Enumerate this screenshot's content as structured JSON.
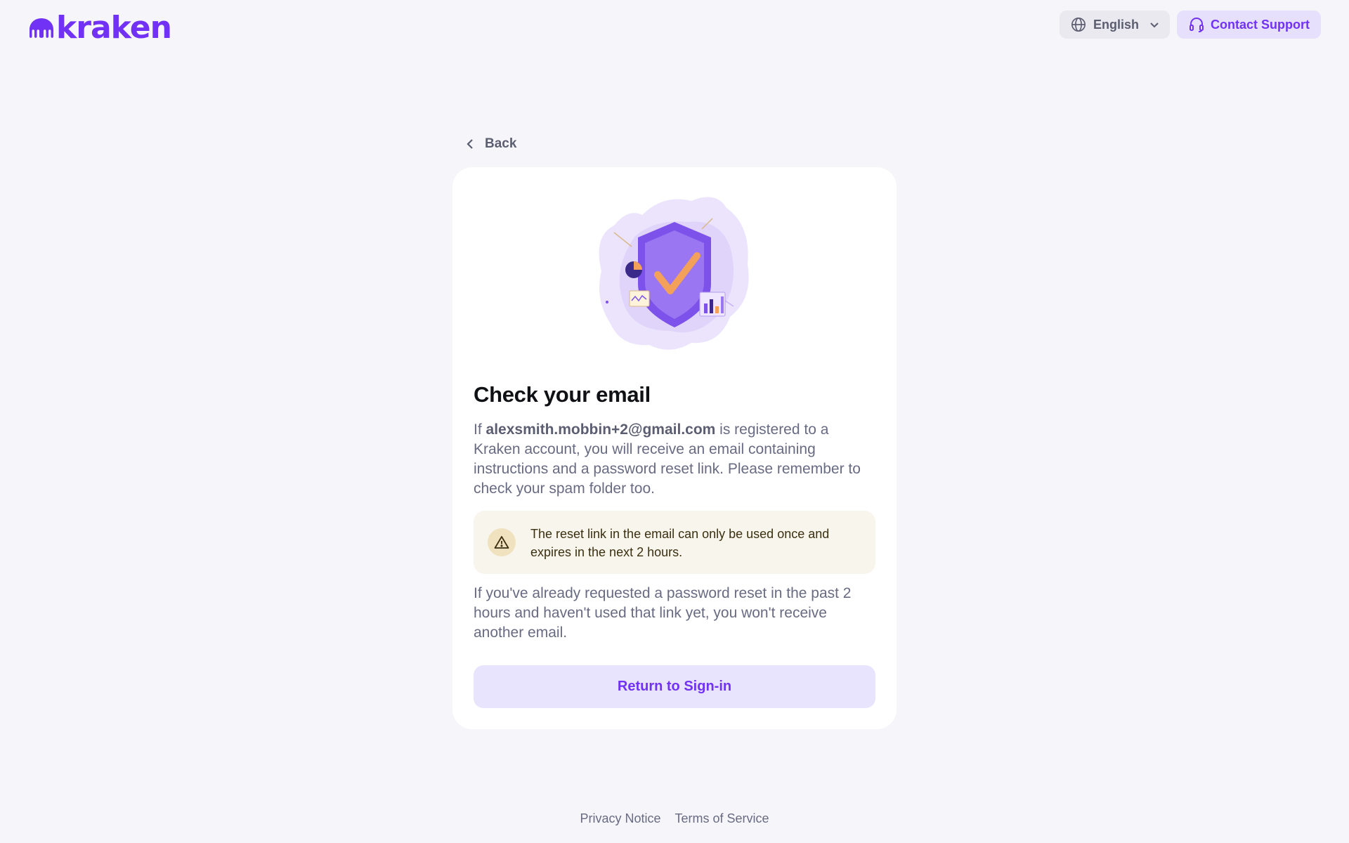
{
  "header": {
    "logo_text": "kraken",
    "language": {
      "label": "English",
      "icon": "globe-icon",
      "chevron": "chevron-down-icon"
    },
    "support": {
      "label": "Contact Support",
      "icon": "headset-icon"
    }
  },
  "back": {
    "label": "Back",
    "icon": "chevron-left-icon"
  },
  "card": {
    "illustration": "shield-check-illustration",
    "title": "Check your email",
    "para1": {
      "prefix": "If ",
      "email": "alexsmith.mobbin+2@gmail.com",
      "suffix": " is registered to a Kraken account, you will receive an email containing instructions and a password reset link. Please remember to check your spam folder too."
    },
    "warning": {
      "icon": "warning-triangle-icon",
      "text": "The reset link in the email can only be used once and expires in the next 2 hours."
    },
    "para2": "If you've already requested a password reset in the past 2 hours and haven't used that link yet, you won't receive another email.",
    "return_label": "Return to Sign-in"
  },
  "footer": {
    "privacy": "Privacy Notice",
    "terms": "Terms of Service"
  },
  "colors": {
    "brand": "#7132f5",
    "background": "#f5f5fa",
    "warning_bg": "#f8f5ec"
  }
}
